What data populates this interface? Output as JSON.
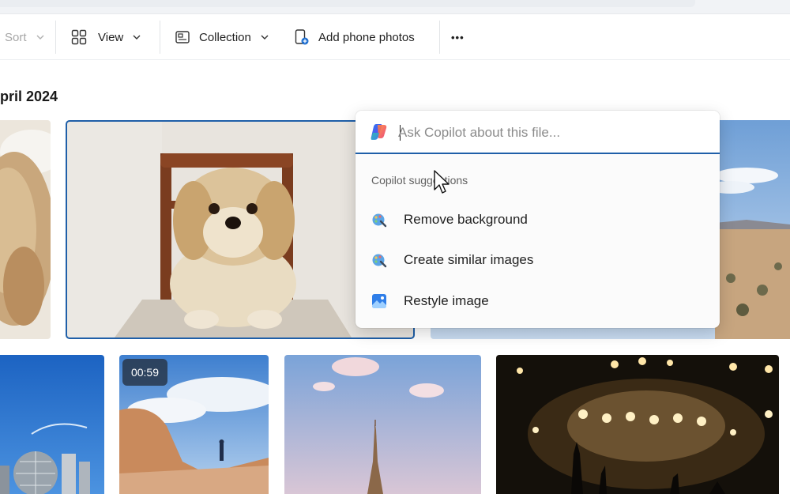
{
  "toolbar": {
    "sort_label": "Sort",
    "view_label": "View",
    "collection_label": "Collection",
    "add_phone_label": "Add phone photos",
    "more_label": "•••"
  },
  "section": {
    "date_header": "pril 2024"
  },
  "photos": {
    "video_duration": "00:59"
  },
  "copilot": {
    "placeholder": "Ask Copilot about this file...",
    "suggestions_title": "Copilot suggestions",
    "suggestions": [
      {
        "label": "Remove background",
        "icon": "paint-brush-icon"
      },
      {
        "label": "Create similar images",
        "icon": "paint-brush-icon"
      },
      {
        "label": "Restyle image",
        "icon": "image-icon"
      }
    ]
  },
  "colors": {
    "accent": "#1f5fa8"
  }
}
